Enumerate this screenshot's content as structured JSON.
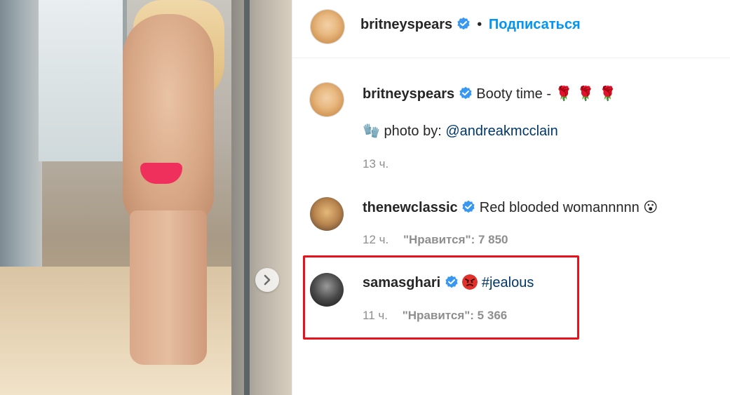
{
  "header": {
    "username": "britneyspears",
    "separator": "•",
    "follow_label": "Подписаться"
  },
  "comments": [
    {
      "username": "britneyspears",
      "text": "Booty time -",
      "emoji_suffix": "🌹 🌹 🌹",
      "line2_emoji": "🧤",
      "line2_text": "photo by:",
      "mention": "@andreakmcclain",
      "time": "13 ч."
    },
    {
      "username": "thenewclassic",
      "text": "Red blooded womannnnn",
      "emoji_suffix": "😮",
      "time": "12 ч.",
      "likes": "\"Нравится\": 7 850"
    },
    {
      "username": "samasghari",
      "hashtag": "#jealous",
      "time": "11 ч.",
      "likes": "\"Нравится\": 5 366"
    }
  ],
  "colors": {
    "follow_blue": "#0095f6",
    "link_blue": "#00376b",
    "verified_blue": "#3897f0",
    "highlight_red": "#e8121d"
  }
}
